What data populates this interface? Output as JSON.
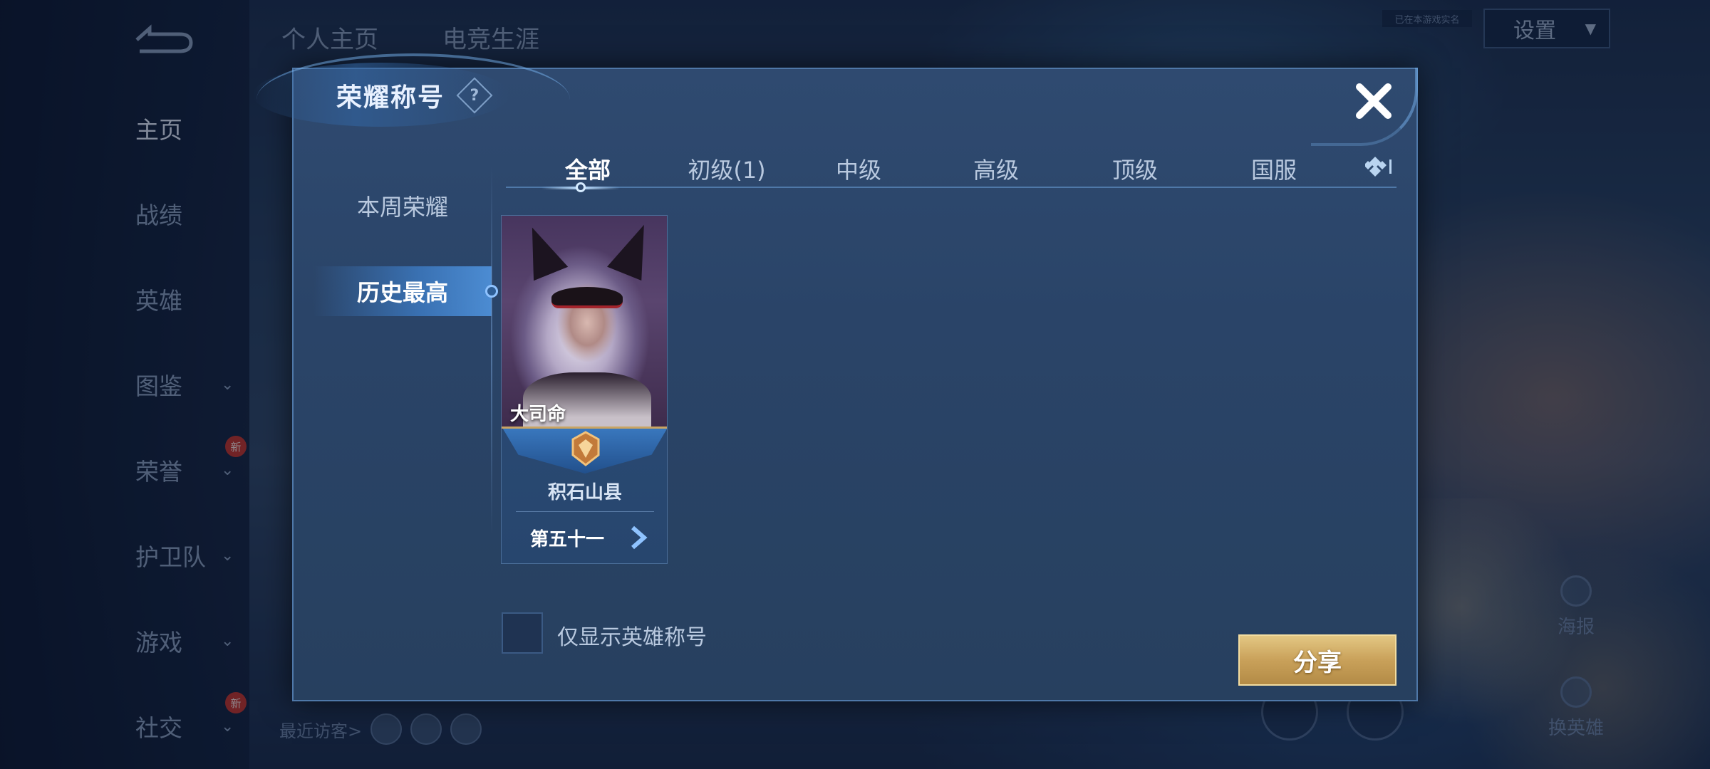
{
  "background": {
    "nav_items": [
      {
        "label": "主页",
        "has_chevron": false,
        "badge": ""
      },
      {
        "label": "战绩",
        "has_chevron": false,
        "badge": ""
      },
      {
        "label": "英雄",
        "has_chevron": false,
        "badge": ""
      },
      {
        "label": "图鉴",
        "has_chevron": true,
        "badge": ""
      },
      {
        "label": "荣誉",
        "has_chevron": true,
        "badge": "新"
      },
      {
        "label": "护卫队",
        "has_chevron": true,
        "badge": ""
      },
      {
        "label": "游戏",
        "has_chevron": true,
        "badge": ""
      },
      {
        "label": "社交",
        "has_chevron": true,
        "badge": "新"
      }
    ],
    "top_tabs": [
      "个人主页",
      "电竞生涯"
    ],
    "settings_label": "设置",
    "top_note": "已在本游戏实名",
    "side_buttons": [
      "海报",
      "换英雄"
    ],
    "recent_visitors_label": "最近访客>"
  },
  "modal": {
    "title": "荣耀称号",
    "help_symbol": "?",
    "side_tabs": [
      {
        "label": "本周荣耀",
        "active": false
      },
      {
        "label": "历史最高",
        "active": true
      }
    ],
    "level_tabs": [
      {
        "label": "全部",
        "active": true
      },
      {
        "label": "初级(1)",
        "active": false
      },
      {
        "label": "中级",
        "active": false
      },
      {
        "label": "高级",
        "active": false
      },
      {
        "label": "顶级",
        "active": false
      },
      {
        "label": "国服",
        "active": false
      }
    ],
    "card": {
      "hero_name": "大司命",
      "region": "积石山县",
      "rank": "第五十一"
    },
    "checkbox_label": "仅显示英雄称号",
    "checkbox_checked": false,
    "share_label": "分享"
  },
  "colors": {
    "accent_gold": "#c9a15a",
    "active_tab_glow": "#5aa6ff",
    "modal_bg": "#2a4468"
  }
}
